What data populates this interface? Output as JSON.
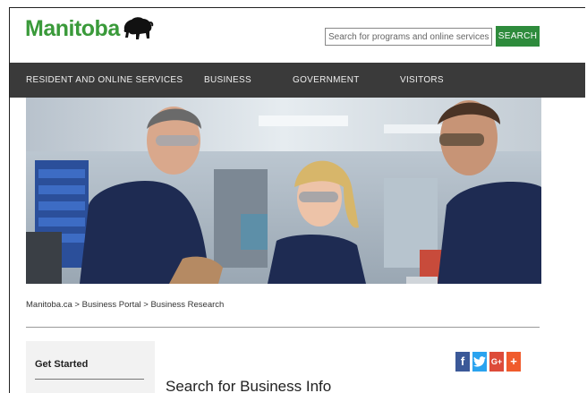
{
  "header": {
    "logo_text": "Manitoba",
    "search_placeholder": "Search for programs and online services",
    "search_button": "SEARCH"
  },
  "nav": {
    "items": [
      {
        "label": "RESIDENT AND ONLINE SERVICES"
      },
      {
        "label": "BUSINESS"
      },
      {
        "label": "GOVERNMENT"
      },
      {
        "label": "VISITORS"
      }
    ]
  },
  "breadcrumb": {
    "items": [
      "Manitoba.ca",
      "Business Portal",
      "Business Research"
    ],
    "separator": ">"
  },
  "sidebar": {
    "title": "Get Started"
  },
  "social": {
    "facebook": "f",
    "twitter": "t",
    "googleplus": "G+",
    "share": "+"
  },
  "content": {
    "title": "Search for Business Info"
  },
  "colors": {
    "brand_green": "#3a9a3a",
    "search_button": "#2e8b3c",
    "nav_bg": "#3a3a3a"
  }
}
